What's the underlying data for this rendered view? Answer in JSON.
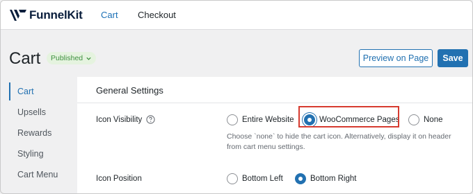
{
  "brand": {
    "name": "FunnelKit"
  },
  "nav": {
    "tabs": [
      {
        "label": "Cart",
        "active": true
      },
      {
        "label": "Checkout",
        "active": false
      }
    ]
  },
  "header": {
    "title": "Cart",
    "status": "Published",
    "preview_label": "Preview on Page",
    "save_label": "Save"
  },
  "sidebar": {
    "items": [
      {
        "label": "Cart",
        "active": true
      },
      {
        "label": "Upsells",
        "active": false
      },
      {
        "label": "Rewards",
        "active": false
      },
      {
        "label": "Styling",
        "active": false
      },
      {
        "label": "Cart Menu",
        "active": false
      }
    ]
  },
  "settings": {
    "section_title": "General Settings",
    "icon_visibility": {
      "label": "Icon Visibility",
      "options": [
        {
          "label": "Entire Website",
          "checked": false
        },
        {
          "label": "WooCommerce Pages",
          "checked": true
        },
        {
          "label": "None",
          "checked": false
        }
      ],
      "help_text": "Choose `none` to hide the cart icon. Alternatively, display it on header from cart menu settings."
    },
    "icon_position": {
      "label": "Icon Position",
      "options": [
        {
          "label": "Bottom Left",
          "checked": false
        },
        {
          "label": "Bottom Right",
          "checked": true
        }
      ]
    }
  },
  "colors": {
    "accent": "#2271b1",
    "highlight": "#d63a2f",
    "badge_bg": "#e5f3df",
    "badge_text": "#3f9140"
  }
}
